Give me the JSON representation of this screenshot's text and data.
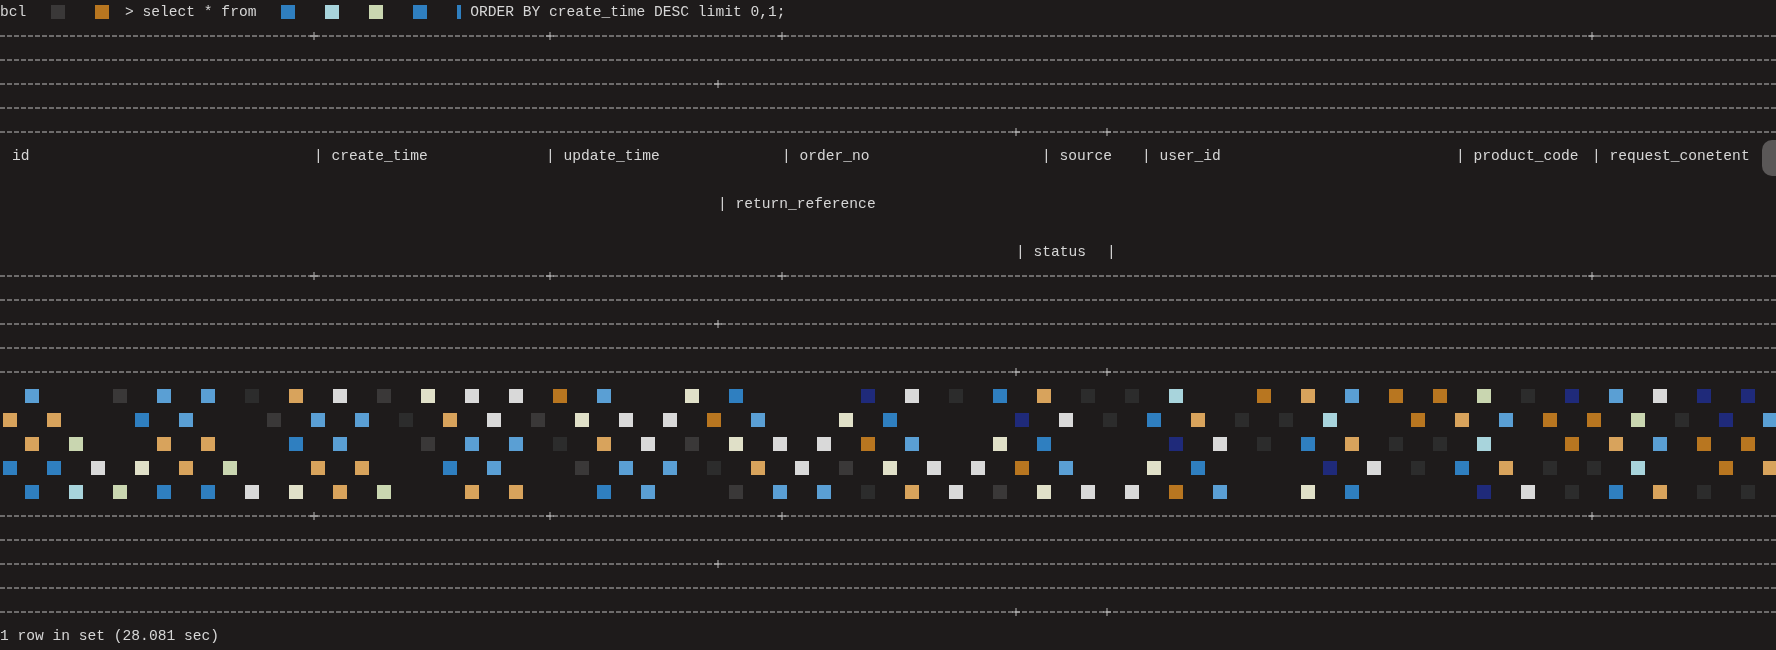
{
  "prompt": {
    "prefix": "bcl",
    "command_start": "> select * from",
    "command_end": "ORDER BY create_time DESC limit 0,1;"
  },
  "header_columns": [
    {
      "label": "id"
    },
    {
      "label": "| create_time"
    },
    {
      "label": "| update_time"
    },
    {
      "label": "| order_no"
    },
    {
      "label": "| source"
    },
    {
      "label": "| user_id"
    },
    {
      "label": "| product_code"
    },
    {
      "label": "| request_conetent"
    }
  ],
  "continuation_column": "| return_reference",
  "status_column": {
    "label": "| status",
    "closing": "|"
  },
  "result": "1 row in set (28.081 sec)"
}
